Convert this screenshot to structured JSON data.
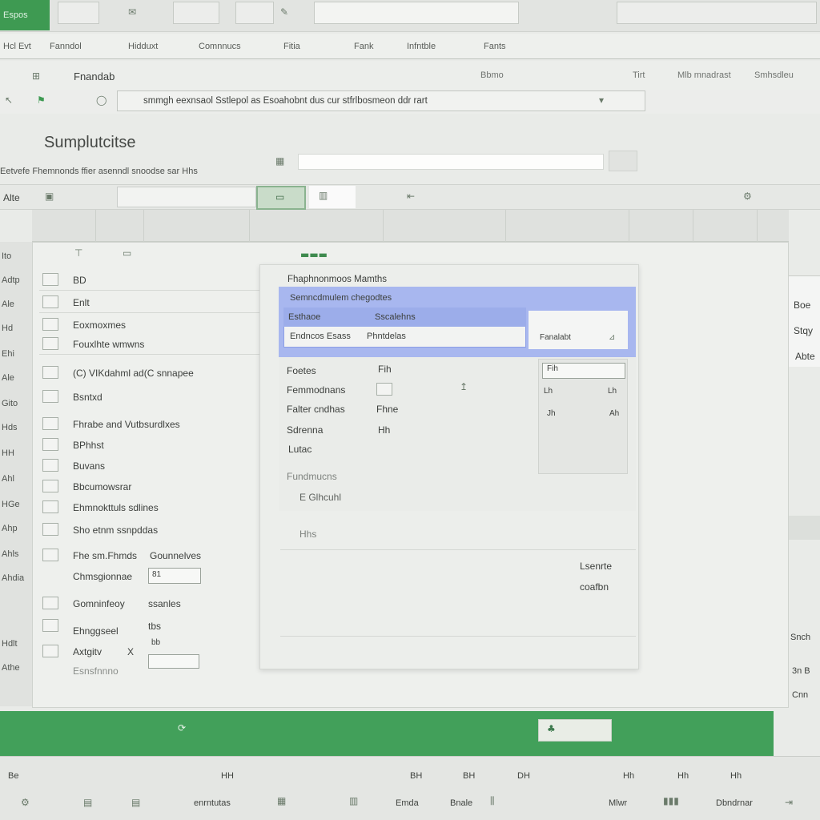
{
  "brand": {
    "label": "Espos"
  },
  "menu": [
    "Hcl Evt",
    "Fanndol",
    "Hidduxt",
    "Comnnucs",
    "Fitia",
    "Fank",
    "Infntble",
    "Fants"
  ],
  "ribbon": {
    "name": "Fnandab",
    "right": [
      "Bbmo",
      "Tirt",
      "Mlb mnadrast",
      "Smhsdleu"
    ]
  },
  "formula_bar": {
    "text": "smmgh eexnsaol Sstlepol as Esoahobnt dus cur stfrlbosmeon ddr rart"
  },
  "page": {
    "title": "Sumplutcitse",
    "subheader": "Eetvefe Fhemnonds ffier asenndl snoodse sar  Hhs",
    "side_label": "Alte"
  },
  "left_row_labels": [
    "Ito",
    "Adtp",
    "Ale",
    "Hd",
    "Ehi",
    "Ale",
    "Gito",
    "Hds",
    "HH",
    "Ahl",
    "HGe",
    "Ahp",
    "Ahls",
    "Ahdia",
    "Hdlt",
    "Athe"
  ],
  "panel": {
    "items": [
      "BD",
      "Enlt",
      "Eoxmoxmes",
      "Fouxlhte wmwns",
      "(C) VIKdahml ad(C snnapee",
      "Bsntxd",
      "Fhrabe and Vutbsurdlxes",
      "BPhhst",
      "Buvans",
      "Bbcumowsrar",
      "Ehmnokttuls sdlines",
      "Sho etnm ssnpddas"
    ],
    "form": [
      {
        "label": "Fhe sm.Fhmds",
        "extra": "Gounnelves"
      },
      {
        "label": "Chmsgionnae",
        "value": "81"
      },
      {
        "label": "Gomninfeoy",
        "extra": "ssanles"
      },
      {
        "label": "",
        "extra": "tbs"
      },
      {
        "label": "Ehnggseel",
        "value": "bb"
      },
      {
        "label": "Axtgitv",
        "extra": "X"
      },
      {
        "label": "Esnsfnnno",
        "value": ""
      }
    ]
  },
  "dialog": {
    "title": "Fhaphnonmoos Mamths",
    "header": "Semncdmulem chegodtes",
    "selected_row": {
      "a": "Esthaoe",
      "b": "Sscalehns"
    },
    "row2": {
      "a": "Endncos Esass",
      "b": "Phntdelas"
    },
    "side": "Fanalabt",
    "props": [
      {
        "label": "Foetes",
        "value": "Fih"
      },
      {
        "label": "Femmodnans",
        "value": ""
      },
      {
        "label": "Falter cndhas",
        "value": "Fhne"
      },
      {
        "label": "Sdrenna",
        "value": "Hh"
      },
      {
        "label": "Lutac",
        "value": ""
      }
    ],
    "subbox": [
      "Fih",
      "Lh",
      "Lh",
      "Jh",
      "Ah"
    ],
    "note1": "Fundmucns",
    "note2": "E Glhcuhl",
    "note3": "Hhs",
    "foot1": "Lsenrte",
    "foot2": "coafbn"
  },
  "right_pane": [
    "Boe",
    "Stqy",
    "Abte"
  ],
  "right_pane_bottom": [
    "Snch",
    "3n B",
    "Cnn"
  ],
  "bottom_bar": {
    "top": [
      "Be",
      "HH",
      "BH",
      "DH",
      "Hh",
      "Hh",
      "Hh",
      "BH"
    ],
    "bottom": [
      "enrntutas",
      "Emda",
      "Bnale",
      "Mlwr",
      "Dbndrnar"
    ]
  }
}
